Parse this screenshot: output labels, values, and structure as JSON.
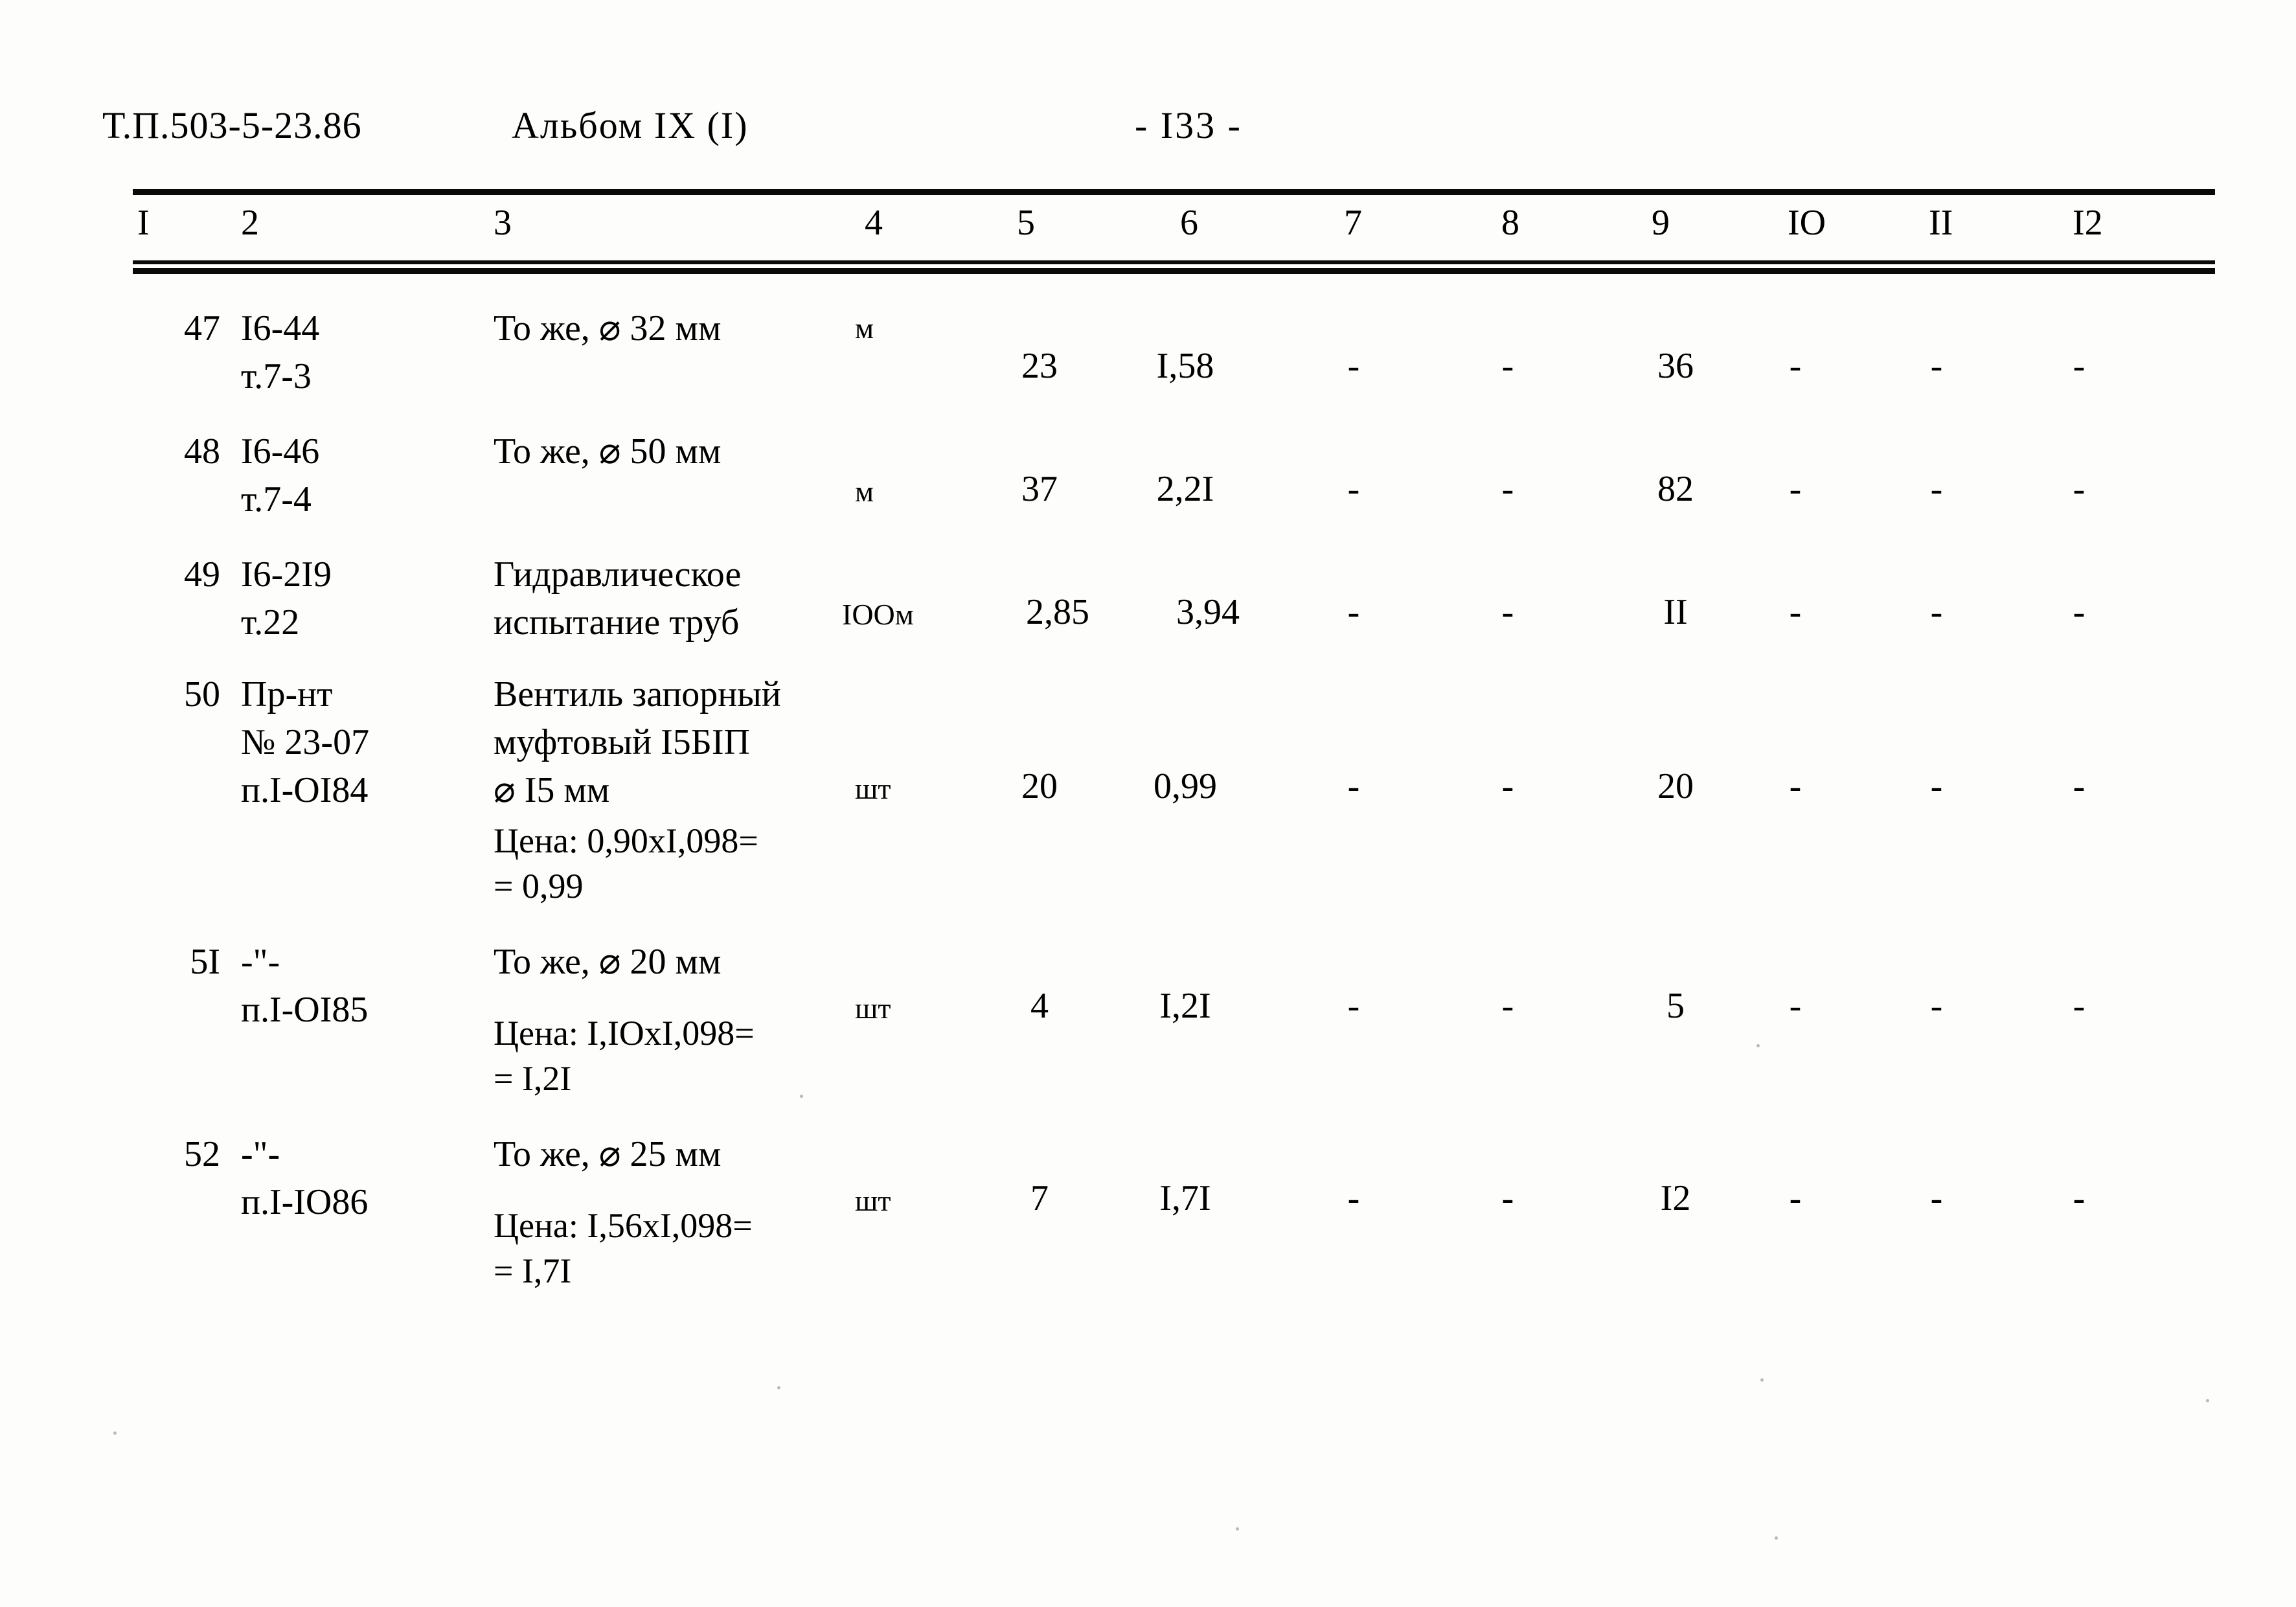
{
  "header": {
    "doc_code": "Т.П.503-5-23.86",
    "album": "Альбом IX (I)",
    "page_number": "- I33 -"
  },
  "table": {
    "column_headers": [
      "I",
      "2",
      "3",
      "4",
      "5",
      "6",
      "7",
      "8",
      "9",
      "IO",
      "II",
      "I2"
    ],
    "rows": [
      {
        "col1": "47",
        "col2": "I6-44\nт.7-3",
        "col3": "То же, ⌀ 32 мм",
        "price_note": "",
        "col4": "м",
        "col5": "23",
        "col6": "I,58",
        "col7": "-",
        "col8": "-",
        "col9": "36",
        "col10": "-",
        "col11": "-",
        "col12": "-"
      },
      {
        "col1": "48",
        "col2": "I6-46\nт.7-4",
        "col3": "То же, ⌀ 50 мм",
        "price_note": "",
        "col4": "м",
        "col5": "37",
        "col6": "2,2I",
        "col7": "-",
        "col8": "-",
        "col9": "82",
        "col10": "-",
        "col11": "-",
        "col12": "-"
      },
      {
        "col1": "49",
        "col2": "I6-2I9\nт.22",
        "col3": "Гидравлическое\nиспытание труб",
        "price_note": "",
        "col4": "IOOм",
        "col5": "2,85",
        "col6": "3,94",
        "col7": "-",
        "col8": "-",
        "col9": "II",
        "col10": "-",
        "col11": "-",
        "col12": "-"
      },
      {
        "col1": "50",
        "col2": "Пр-нт\n№ 23-07\nп.I-OI84",
        "col3": "Вентиль запорный\nмуфтовый I5БIП\n⌀ I5 мм",
        "price_note": "Цена: 0,90xI,098=\n= 0,99",
        "col4": "шт",
        "col5": "20",
        "col6": "0,99",
        "col7": "-",
        "col8": "-",
        "col9": "20",
        "col10": "-",
        "col11": "-",
        "col12": "-"
      },
      {
        "col1": "5I",
        "col2": "-\"-\nп.I-OI85",
        "col3": "То же, ⌀ 20 мм",
        "price_note": "Цена: I,IOxI,098=\n= I,2I",
        "col4": "шт",
        "col5": "4",
        "col6": "I,2I",
        "col7": "-",
        "col8": "-",
        "col9": "5",
        "col10": "-",
        "col11": "-",
        "col12": "-"
      },
      {
        "col1": "52",
        "col2": "-\"-\nп.I-IO86",
        "col3": "То же, ⌀ 25 мм",
        "price_note": "Цена: I,56xI,098=\n= I,7I",
        "col4": "шт",
        "col5": "7",
        "col6": "I,7I",
        "col7": "-",
        "col8": "-",
        "col9": "I2",
        "col10": "-",
        "col11": "-",
        "col12": "-"
      }
    ]
  }
}
